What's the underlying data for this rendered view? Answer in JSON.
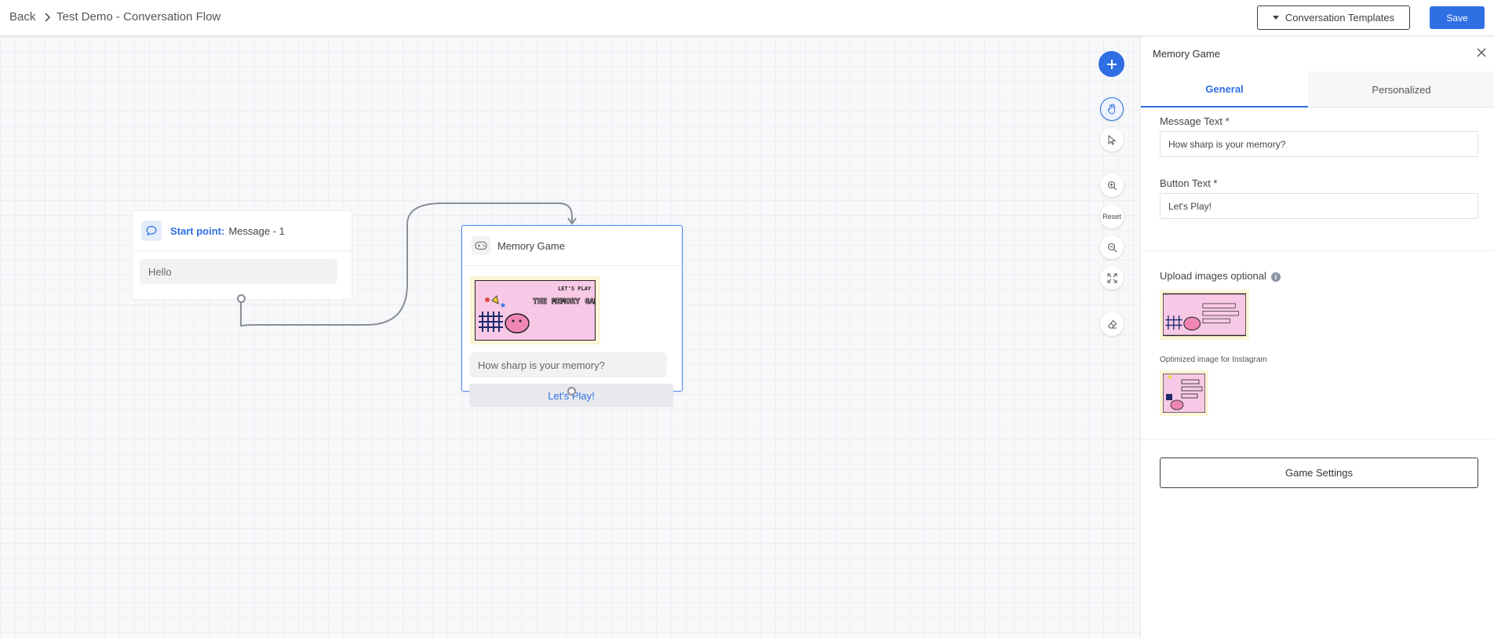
{
  "header": {
    "back_label": "Back",
    "flow_title": "Test Demo - Conversation Flow",
    "templates_label": "Conversation Templates",
    "save_label": "Save"
  },
  "canvas": {
    "start_node": {
      "label": "Start point:",
      "message": "Message - 1",
      "text": "Hello"
    },
    "game_node": {
      "title": "Memory Game",
      "image_caption_top": "LET'S PLAY",
      "image_caption_main": "THE MEMORY GAME",
      "question": "How sharp is your memory?",
      "button_label": "Let's Play!"
    },
    "toolbar": {
      "reset_label": "Reset"
    }
  },
  "panel": {
    "title": "Memory Game",
    "tabs": [
      {
        "label": "General",
        "active": true
      },
      {
        "label": "Personalized",
        "active": false
      }
    ],
    "message_text_label": "Message Text *",
    "message_text_value": "How sharp is your memory?",
    "button_text_label": "Button Text *",
    "button_text_value": "Let's Play!",
    "upload_label": "Upload images optional",
    "optimized_label": "Optimized image for Instagram",
    "game_settings_label": "Game Settings"
  },
  "colors": {
    "accent": "#2f6fe4",
    "image_background": "#f7c9e6",
    "image_frame": "#fbf4d7"
  }
}
